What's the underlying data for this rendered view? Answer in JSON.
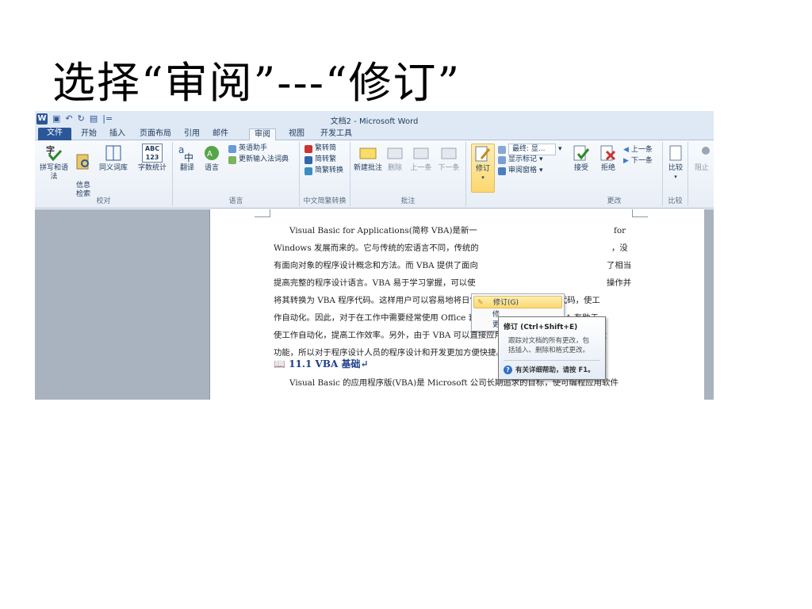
{
  "slide": {
    "title": "选择“审阅”---“修订”"
  },
  "window": {
    "title": "文档2 - Microsoft Word",
    "qat": {
      "logo": "W",
      "separator": "|="
    }
  },
  "tabs": [
    {
      "label": "文件"
    },
    {
      "label": "开始"
    },
    {
      "label": "插入"
    },
    {
      "label": "页面布局"
    },
    {
      "label": "引用"
    },
    {
      "label": "邮件"
    },
    {
      "label": "审阅"
    },
    {
      "label": "视图"
    },
    {
      "label": "开发工具"
    }
  ],
  "ribbon": {
    "proofing": {
      "label": "校对",
      "spelling": "拼写和语法",
      "research": "信息\n检索",
      "thesaurus": "同义词库",
      "wordcount": "字数统计",
      "abc": "ABC",
      "abc_num": "123"
    },
    "language": {
      "label": "语言",
      "translate": "翻译",
      "language": "语言",
      "english_assistant": "英语助手",
      "update_ime": "更新输入法词典"
    },
    "chinese": {
      "label": "中文简繁转换",
      "to_simplified": "繁转简",
      "to_traditional": "简转繁",
      "convert": "简繁转换"
    },
    "comments": {
      "label": "批注",
      "new": "新建批注",
      "delete": "删除",
      "prev": "上一条",
      "next": "下一条"
    },
    "tracking": {
      "track": "修订",
      "display": "最终: 显...",
      "show_markup": "显示标记",
      "reviewing_pane": "审阅窗格"
    },
    "changes": {
      "label": "更改",
      "accept": "接受",
      "reject": "拒绝",
      "prev": "上一条",
      "next": "下一条"
    },
    "compare": {
      "label": "比较",
      "compare": "比较"
    },
    "protect": {
      "block": "阻止"
    }
  },
  "dropdown": {
    "item1": "修订(G)",
    "item2": "修",
    "item3": "更"
  },
  "tooltip": {
    "title": "修订 (Ctrl+Shift+E)",
    "body_line1": "跟踪对文档的所有更改，包",
    "body_line2": "括插入、删除和格式更改。",
    "help": "有关详细帮助，请按 F1。"
  },
  "document": {
    "lines": [
      "Visual Basic for Applications(简称 VBA)是新一",
      "Windows 发展而来的。它与传统的宏语言不同，传统的",
      "有面向对象的程序设计概念和方法。而 VBA 提供了面向",
      "提高完整的程序设计语言。VBA 易于学习掌握，可以使",
      "将其转换为 VBA 程序代码。这样用户可以容易地将日常工作转换为 VBA 程序代码，使工",
      "作自动化。因此，对于在工作中需要经常使用 Office 套装软件的用户，学用 VBA 有助于",
      "使工作自动化，提高工作效率。另外，由于 VBA 可以直接应用 Office 套装软件的各项强大",
      "功能，所以对于程序设计人员的程序设计和开发更加方便快捷。↵"
    ],
    "line1_tail": "for",
    "line2_tail": "，没",
    "line3_tail": "了相当",
    "line4_tail": "操作并",
    "heading": "11.1 VBA 基础↵",
    "para2": "Visual Basic 的应用程序版(VBA)是 Microsoft 公司长期追求的目标，使可编程应用软件"
  },
  "colors": {
    "file_tab": "#2b579a",
    "ribbon_bg": "#dfe9f5",
    "highlight": "#fbd870",
    "heading": "#1f3f8c",
    "gutter": "#a9b3bf"
  }
}
